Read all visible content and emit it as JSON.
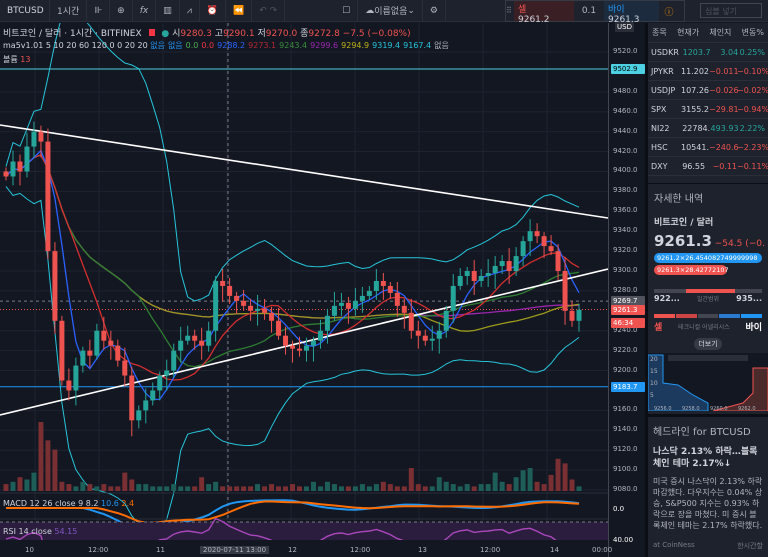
{
  "toolbar": {
    "symbol": "BTCUSD",
    "interval": "1시간",
    "layout_name": "이름없음",
    "search_placeholder": "심볼 넣기"
  },
  "trade": {
    "sell_label": "셀",
    "sell_price": "9261.2",
    "qty": "0.1",
    "buy_label": "바이",
    "buy_price": "9261.3"
  },
  "legend": {
    "title": "비트코인 / 달러 · 1시간 · BITFINEX",
    "o_label": "시",
    "o": "9280.3",
    "h_label": "고",
    "h": "9290.1",
    "l_label": "저",
    "l": "9270.0",
    "c_label": "종",
    "c": "9272.8",
    "chg": "−7.5 (−0.08%)",
    "ma_label": "ma5v1.01 5 10 20 60 120 0 0 20 20",
    "ma_vals": [
      {
        "v": "없음",
        "c": "#2196f3"
      },
      {
        "v": "없음",
        "c": "#2196f3"
      },
      {
        "v": "0.0",
        "c": "#4caf50"
      },
      {
        "v": "0.0",
        "c": "#f23645"
      },
      {
        "v": "9288.2",
        "c": "#2962ff"
      },
      {
        "v": "9273.1",
        "c": "#b22833"
      },
      {
        "v": "9243.4",
        "c": "#388e3c"
      },
      {
        "v": "9299.6",
        "c": "#9c27b0"
      },
      {
        "v": "9294.9",
        "c": "#bcb21a"
      },
      {
        "v": "9319.4",
        "c": "#26c6da"
      },
      {
        "v": "9167.4",
        "c": "#26c6da"
      },
      {
        "v": "없음",
        "c": "#b2b5be"
      }
    ],
    "vol_label": "볼륨",
    "vol": "13",
    "macd_label": "MACD 12 26 close 9",
    "macd": "8.2",
    "macd_sig": "10.6",
    "macd_hist": "2.4",
    "rsi_label": "RSI 14 close",
    "rsi": "54.15"
  },
  "axis": {
    "ticks": [
      "9520.0",
      "9480.0",
      "9460.0",
      "9440.0",
      "9420.0",
      "9400.0",
      "9380.0",
      "9360.0",
      "9340.0",
      "9320.0",
      "9300.0",
      "9280.0",
      "9240.0",
      "9220.0",
      "9200.0",
      "9160.0",
      "9140.0",
      "9120.0",
      "9100.0",
      "9080.0"
    ],
    "tick_prices": [
      9520,
      9480,
      9460,
      9440,
      9420,
      9400,
      9380,
      9360,
      9340,
      9320,
      9300,
      9280,
      9240,
      9220,
      9200,
      9160,
      9140,
      9120,
      9100,
      9080
    ],
    "hline_high": "9502.9",
    "crosshair": "9269.7",
    "last": "9261.3",
    "countdown": "46:34",
    "hline_low": "9183.7",
    "macd_zero": "0.0",
    "rsi_level": "40.00",
    "currency": "USD"
  },
  "time": [
    "10",
    "12:00",
    "11",
    "2020-07-11 13:00",
    "12",
    "12:00",
    "13",
    "12:00",
    "14",
    "00:00"
  ],
  "chart": {
    "closes": [
      9395,
      9410,
      9400,
      9425,
      9440,
      9430,
      9320,
      9250,
      9190,
      9180,
      9205,
      9220,
      9215,
      9240,
      9230,
      9225,
      9210,
      9195,
      9150,
      9160,
      9170,
      9180,
      9195,
      9200,
      9220,
      9230,
      9235,
      9230,
      9225,
      9240,
      9290,
      9285,
      9275,
      9270,
      9265,
      9260,
      9262,
      9258,
      9250,
      9235,
      9225,
      9222,
      9220,
      9225,
      9230,
      9240,
      9255,
      9265,
      9268,
      9262,
      9270,
      9275,
      9280,
      9290,
      9285,
      9278,
      9265,
      9258,
      9240,
      9235,
      9230,
      9232,
      9240,
      9260,
      9285,
      9295,
      9300,
      9290,
      9295,
      9298,
      9305,
      9310,
      9300,
      9315,
      9330,
      9340,
      9335,
      9325,
      9320,
      9300,
      9260,
      9250,
      9261
    ],
    "volumes": [
      3,
      4,
      6,
      5,
      8,
      30,
      22,
      18,
      4,
      3,
      2,
      4,
      3,
      2,
      3,
      2,
      2,
      8,
      5,
      3,
      3,
      2,
      2,
      2,
      3,
      2,
      2,
      2,
      6,
      3,
      4,
      2,
      2,
      2,
      2,
      2,
      3,
      2,
      3,
      2,
      2,
      3,
      2,
      2,
      4,
      2,
      4,
      3,
      2,
      2,
      2,
      3,
      2,
      3,
      4,
      3,
      2,
      2,
      10,
      3,
      2,
      2,
      6,
      4,
      3,
      2,
      3,
      2,
      3,
      3,
      8,
      4,
      3,
      6,
      9,
      10,
      4,
      3,
      7,
      14,
      12,
      5,
      2
    ]
  },
  "watchlist": {
    "headers": [
      "종목",
      "현재가",
      "체인지",
      "변동%"
    ],
    "rows": [
      {
        "sym": "USDKR",
        "price": "1203.7",
        "chg": "3.04",
        "pct": "0.25%",
        "up": true
      },
      {
        "sym": "JPYKR",
        "price": "11.202",
        "chg": "−0.011",
        "pct": "−0.10%",
        "up": false
      },
      {
        "sym": "USDJP",
        "price": "107.26",
        "chg": "−0.026",
        "pct": "−0.02%",
        "up": false
      },
      {
        "sym": "SPX",
        "price": "3155.2",
        "chg": "−29.81",
        "pct": "−0.94%",
        "up": false
      },
      {
        "sym": "NI22",
        "price": "22784.",
        "chg": "493.93",
        "pct": "2.22%",
        "up": true
      },
      {
        "sym": "HSC",
        "price": "10541.",
        "chg": "−240.6",
        "pct": "−2.23%",
        "up": false
      },
      {
        "sym": "DXY",
        "price": "96.55",
        "chg": "−0.11",
        "pct": "−0.11%",
        "up": false
      }
    ]
  },
  "details": {
    "title": "자세한 내역",
    "name": "비트코인 / 달러",
    "price": "9261.3",
    "chg": "−54.5 (−0.",
    "bid": "9261.2×26.454082749999998",
    "ask": "9261.3×28.42772107",
    "low": "922...",
    "high": "935...",
    "range_label": "일간범위",
    "sell": "셀",
    "tech_label": "테크니컬 어낼리시스",
    "buy": "바이",
    "more": "더보기",
    "depth_y": [
      "20",
      "15",
      "10",
      "5"
    ],
    "depth_x": [
      "9256.0",
      "9258.0",
      "9260.0",
      "9262.0"
    ]
  },
  "headlines": {
    "title": "헤드라인 for BTCUSD",
    "headline": "나스닥 2.13% 하락…블록체인 테마 2.17%↓",
    "body": "미국 증시 나스닥이 2.13% 하락 마감했다. 다우지수는 0.04% 상승, S&P500 지수는 0.93% 하락으로 장을 마쳤다. 미 증시 블록체인 테마는 2.17% 하락했다.",
    "source": "at CoinNess",
    "more": "한시간할"
  }
}
